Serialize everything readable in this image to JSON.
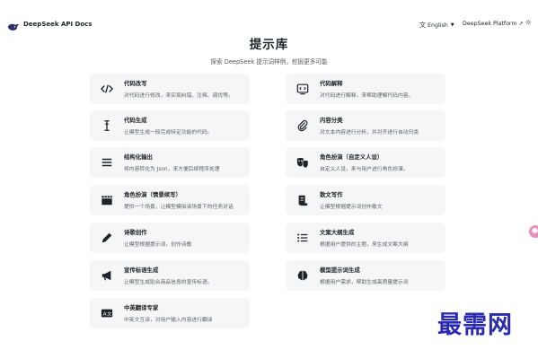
{
  "header": {
    "brand": "DeepSeek API Docs",
    "language": "English",
    "platform_link": "DeepSeek Platform"
  },
  "page": {
    "title": "提示库",
    "subtitle": "探索 DeepSeek 提示词样例，挖掘更多可能"
  },
  "cards": [
    {
      "title": "代码改写",
      "desc": "对代码进行修改，来实现纠错、注释、调优等。",
      "icon": "code-brackets-icon"
    },
    {
      "title": "代码解释",
      "desc": "对代码进行解释，来帮助理解代码内容。",
      "icon": "code-terminal-icon"
    },
    {
      "title": "代码生成",
      "desc": "让模型生成一段完成特定功能的代码。",
      "icon": "text-cursor-icon"
    },
    {
      "title": "内容分类",
      "desc": "对文本内容进行分析，并对齐进行自动归类",
      "icon": "paperclip-icon"
    },
    {
      "title": "结构化输出",
      "desc": "将内容转化为 Json，来方便后续程序处理",
      "icon": "list-lines-icon"
    },
    {
      "title": "角色扮演（自定义人设）",
      "desc": "自定义人设，来与用户进行角色扮演。",
      "icon": "theater-masks-icon"
    },
    {
      "title": "角色扮演（情景续写）",
      "desc": "提供一个场景，让模型模拟该场景下的任务对话",
      "icon": "clapperboard-icon"
    },
    {
      "title": "散文写作",
      "desc": "让模型根据提示词创作散文",
      "icon": "scroll-icon"
    },
    {
      "title": "诗歌创作",
      "desc": "让模型根据提示词，创作诗歌",
      "icon": "pen-icon"
    },
    {
      "title": "文案大纲生成",
      "desc": "根据用户提供的主题，来生成文案大纲",
      "icon": "bullet-list-icon"
    },
    {
      "title": "宣传标语生成",
      "desc": "让模型生成贴合商品信息的宣传标语。",
      "icon": "megaphone-icon"
    },
    {
      "title": "模型提示词生成",
      "desc": "根据用户需求，帮助生成高质量提示词",
      "icon": "brain-icon"
    },
    {
      "title": "中英翻译专家",
      "desc": "中英文互译，对用户输入内容进行翻译",
      "icon": "translate-icon"
    }
  ],
  "watermark": "最需网"
}
